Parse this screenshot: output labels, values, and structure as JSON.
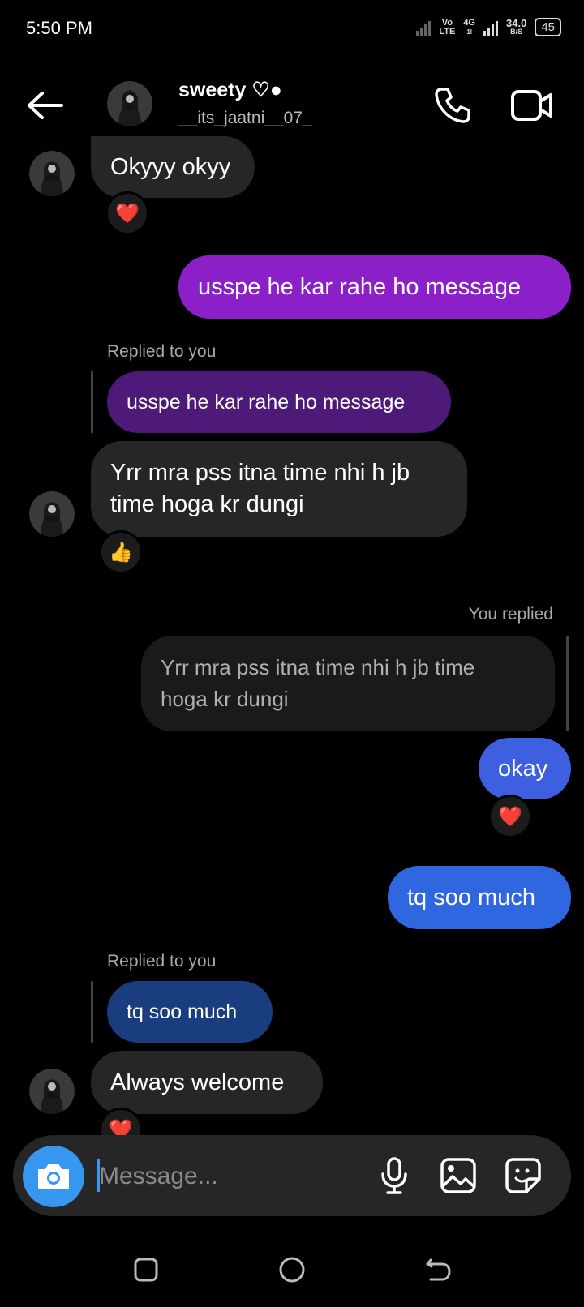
{
  "status_bar": {
    "time": "5:50 PM",
    "volte_top": "Vo",
    "volte_bottom": "LTE",
    "network": "4G",
    "network_sub": "1l",
    "speed_value": "34.0",
    "speed_unit": "B/S",
    "battery": "45"
  },
  "header": {
    "name": "sweety ♡●",
    "username": "__its_jaatni__07_"
  },
  "messages": [
    {
      "side": "received",
      "text": "Okyyy okyy",
      "reaction": "❤️"
    },
    {
      "side": "sent",
      "text": "usspe he kar rahe ho message"
    },
    {
      "side": "received",
      "reply_label": "Replied to you",
      "quoted": "usspe he kar rahe ho message",
      "text_line1": "Yrr mra pss itna time nhi h jb",
      "text_line2": "time hoga kr dungi",
      "reaction": "👍"
    },
    {
      "side": "sent",
      "reply_label": "You replied",
      "quoted_line1": "Yrr mra pss itna time nhi h jb time",
      "quoted_line2": "hoga kr dungi",
      "text": "okay",
      "reaction": "❤️"
    },
    {
      "side": "sent",
      "text": "tq soo much"
    },
    {
      "side": "received",
      "reply_label": "Replied to you",
      "quoted": "tq soo much",
      "text": "Always welcome",
      "reaction": "❤️"
    }
  ],
  "composer": {
    "placeholder": "Message..."
  },
  "colors": {
    "sent_purple": "#8b1fc8",
    "sent_blue": "#2f67e0",
    "received_gray": "#262626",
    "accent": "#3797f0"
  }
}
